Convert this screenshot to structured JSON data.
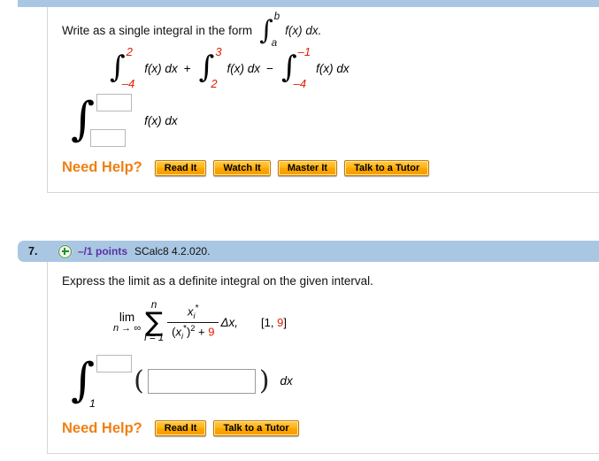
{
  "page": {
    "background": "#ffffff",
    "accent_orange": "#f07f13",
    "header_blue": "#a9c7e2",
    "points_purple": "#5d30a6",
    "math_red": "#e01b00"
  },
  "questions": [
    {
      "id": "q6",
      "header_visible": false,
      "prompt": {
        "text_before": "Write as a single integral in the form",
        "integral": {
          "upper": "b",
          "lower": "a",
          "integrand": "f(x) dx."
        }
      },
      "given_expression": {
        "terms": [
          {
            "upper": "2",
            "lower": "–4",
            "integrand": "f(x) dx"
          },
          {
            "operator": "+",
            "upper": "3",
            "lower": "2",
            "integrand": "f(x) dx"
          },
          {
            "operator": "−",
            "upper": "–1",
            "lower": "–4",
            "integrand": "f(x) dx"
          }
        ]
      },
      "answer": {
        "upper_value": "",
        "upper_placeholder": "",
        "lower_value": "",
        "lower_placeholder": "",
        "integrand": "f(x) dx"
      },
      "need_help": {
        "label": "Need Help?",
        "buttons": [
          "Read It",
          "Watch It",
          "Master It",
          "Talk to a Tutor"
        ]
      }
    },
    {
      "id": "q7",
      "header_visible": true,
      "header": {
        "number": "7.",
        "plus_icon": "plus-circle-icon",
        "points": "–/1 points",
        "source": "SCalc8 4.2.020."
      },
      "prompt": {
        "text": "Express the limit as a definite integral on the given interval."
      },
      "limit_expression": {
        "lim_label": "lim",
        "lim_subscript": "n → ∞",
        "sigma_top": "n",
        "sigma_bottom": "i = 1",
        "numerator": "xᵢ*",
        "denominator_left": "(xᵢ*)² +",
        "denominator_red": "9",
        "delta": "Δx,",
        "interval_open": "[1,",
        "interval_red": "9",
        "interval_close": "]"
      },
      "answer": {
        "upper_value": "",
        "upper_placeholder": "",
        "lower_fixed": "1",
        "body_value": "",
        "body_placeholder": "",
        "tail": "dx"
      },
      "need_help": {
        "label": "Need Help?",
        "buttons": [
          "Read It",
          "Talk to a Tutor"
        ]
      }
    }
  ]
}
